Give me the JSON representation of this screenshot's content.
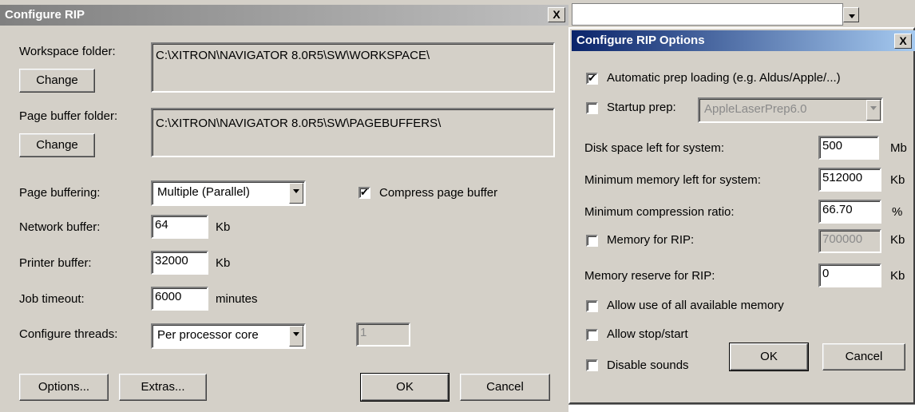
{
  "main": {
    "title": "Configure RIP",
    "close_glyph": "X",
    "workspace_label": "Workspace folder:",
    "workspace_path": "C:\\XITRON\\NAVIGATOR 8.0R5\\SW\\WORKSPACE\\",
    "change_label": "Change",
    "pagebuffer_label": "Page buffer folder:",
    "pagebuffer_path": "C:\\XITRON\\NAVIGATOR 8.0R5\\SW\\PAGEBUFFERS\\",
    "page_buffering_label": "Page buffering:",
    "page_buffering_value": "Multiple (Parallel)",
    "compress_label": "Compress page buffer",
    "compress_checked": true,
    "network_buffer_label": "Network buffer:",
    "network_buffer_value": "64",
    "network_buffer_unit": "Kb",
    "printer_buffer_label": "Printer buffer:",
    "printer_buffer_value": "32000",
    "printer_buffer_unit": "Kb",
    "job_timeout_label": "Job timeout:",
    "job_timeout_value": "6000",
    "job_timeout_unit": "minutes",
    "threads_label": "Configure threads:",
    "threads_value": "Per processor core",
    "threads_count": "1",
    "options_button": "Options...",
    "extras_button": "Extras...",
    "ok_button": "OK",
    "cancel_button": "Cancel"
  },
  "options": {
    "title": "Configure RIP Options",
    "close_glyph": "X",
    "auto_prep_label": "Automatic prep loading (e.g. Aldus/Apple/...)",
    "auto_prep_checked": true,
    "startup_prep_label": "Startup prep:",
    "startup_prep_checked": false,
    "startup_prep_value": "AppleLaserPrep6.0",
    "disk_space_label": "Disk space left for system:",
    "disk_space_value": "500",
    "disk_space_unit": "Mb",
    "min_memory_label": "Minimum memory left for system:",
    "min_memory_value": "512000",
    "min_memory_unit": "Kb",
    "min_compression_label": "Minimum compression ratio:",
    "min_compression_value": "66.70",
    "min_compression_unit": "%",
    "memory_rip_label": "Memory for RIP:",
    "memory_rip_checked": false,
    "memory_rip_value": "700000",
    "memory_rip_unit": "Kb",
    "memory_reserve_label": "Memory reserve for RIP:",
    "memory_reserve_value": "0",
    "memory_reserve_unit": "Kb",
    "allow_all_memory_label": "Allow use of all available memory",
    "allow_stop_start_label": "Allow stop/start",
    "disable_sounds_label": "Disable sounds",
    "ok_button": "OK",
    "cancel_button": "Cancel"
  }
}
